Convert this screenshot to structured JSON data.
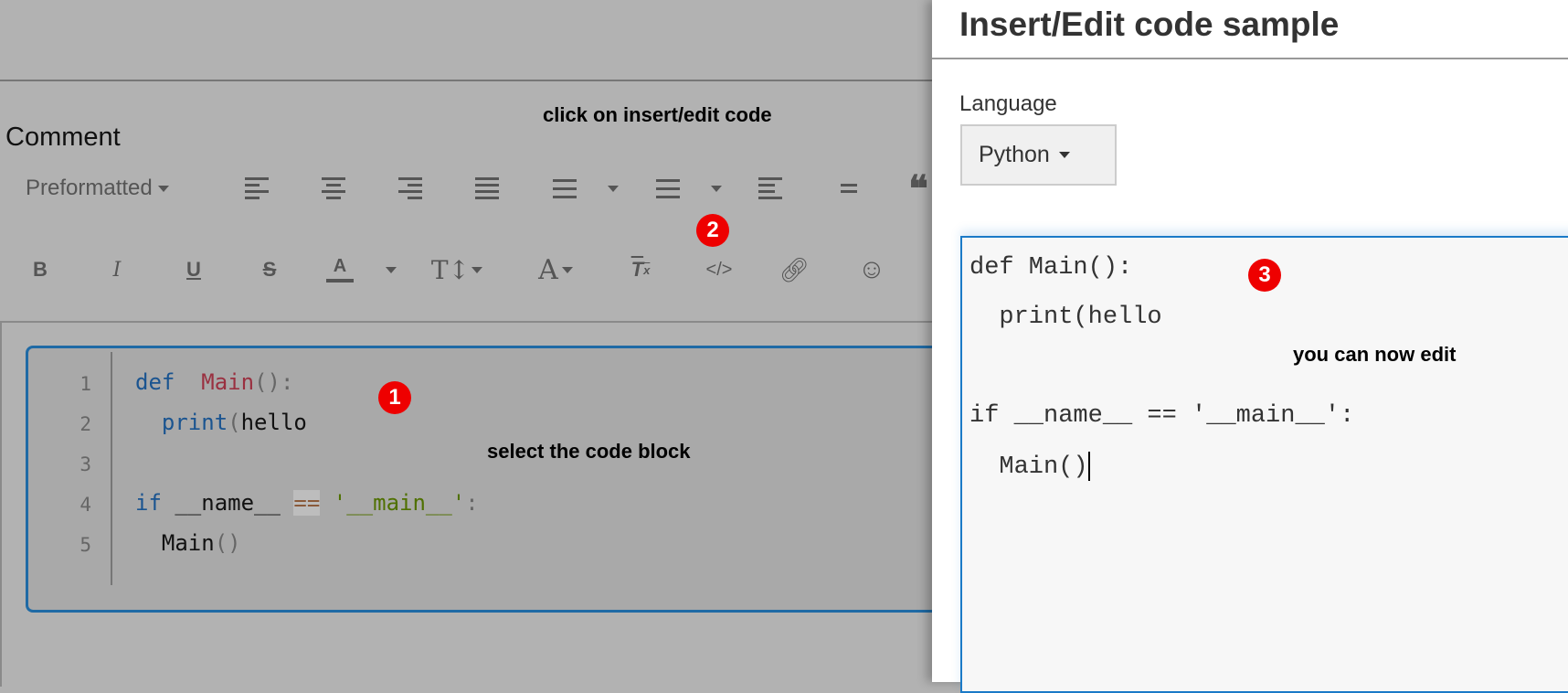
{
  "editor": {
    "label": "Comment",
    "format_select": "Preformatted",
    "code_lines": [
      {
        "num": "1",
        "tokens": [
          [
            "kw",
            "def"
          ],
          [
            "",
            "  "
          ],
          [
            "fn",
            "Main"
          ],
          [
            "pn",
            "():"
          ]
        ]
      },
      {
        "num": "2",
        "tokens": [
          [
            "",
            "  "
          ],
          [
            "kw",
            "print"
          ],
          [
            "pn",
            "("
          ],
          [
            "",
            "hello"
          ]
        ]
      },
      {
        "num": "3",
        "tokens": []
      },
      {
        "num": "4",
        "tokens": [
          [
            "kw",
            "if"
          ],
          [
            "",
            " __name__ "
          ],
          [
            "op",
            "=="
          ],
          [
            "",
            " "
          ],
          [
            "st",
            "'__main__'"
          ],
          [
            "pn",
            ":"
          ]
        ]
      },
      {
        "num": "5",
        "tokens": [
          [
            "",
            "  Main"
          ],
          [
            "pn",
            "()"
          ]
        ]
      }
    ]
  },
  "annotations": {
    "step1": "1",
    "step2": "2",
    "step3": "3",
    "click_note": "click on insert/edit code",
    "select_note": "select the code block",
    "edit_note": "you can now edit"
  },
  "dialog": {
    "title": "Insert/Edit code sample",
    "language_label": "Language",
    "language_value": "Python",
    "code": [
      "def Main():",
      "  print(hello",
      "",
      "if __name__ == '__main__':",
      "  Main()"
    ]
  }
}
